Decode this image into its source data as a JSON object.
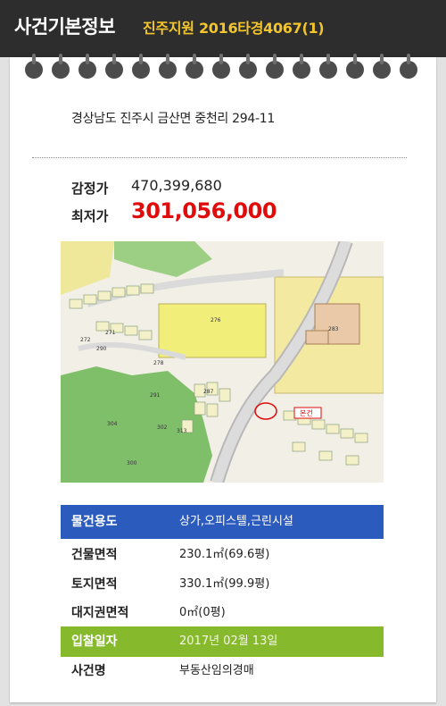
{
  "header": {
    "title": "사건기본정보",
    "case_info": "진주지원 2016타경4067(1)"
  },
  "address": "경상남도 진주시 금산면 중천리 294-11",
  "prices": {
    "appraisal_label": "감정가",
    "appraisal_value": "470,399,680",
    "min_bid_label": "최저가",
    "min_bid_value": "301,056,000"
  },
  "map": {
    "lot_numbers": [
      "276",
      "271",
      "272",
      "278",
      "290",
      "291",
      "287",
      "304",
      "302",
      "300",
      "313",
      "283"
    ],
    "marker_label": "본건"
  },
  "details": [
    {
      "label": "물건용도",
      "value": "상가,오피스텔,근린시설"
    },
    {
      "label": "건물면적",
      "value": "230.1㎡(69.6평)"
    },
    {
      "label": "토지면적",
      "value": "330.1㎡(99.9평)"
    },
    {
      "label": "대지권면적",
      "value": "0㎡(0평)"
    },
    {
      "label": "입찰일자",
      "value": "2017년 02월 13일"
    },
    {
      "label": "사건명",
      "value": "부동산임의경매"
    }
  ],
  "colors": {
    "header_bg": "#2d2d2d",
    "header_accent": "#f3c52d",
    "min_bid": "#e00b0b",
    "row_highlight_blue": "#2b5bbd",
    "row_highlight_green": "#87b92c"
  }
}
